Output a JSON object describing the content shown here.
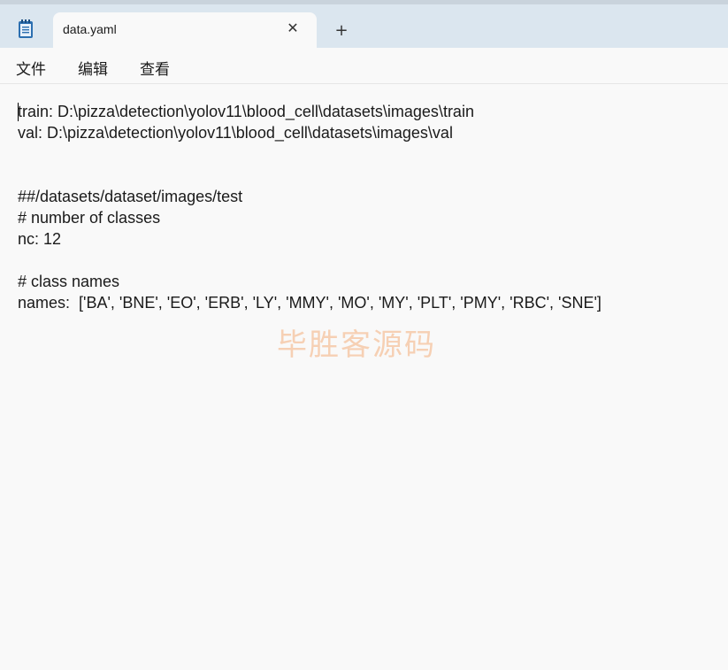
{
  "window": {
    "tab_title": "data.yaml",
    "close_glyph": "✕",
    "new_tab_glyph": "+"
  },
  "menu": {
    "file": "文件",
    "edit": "编辑",
    "view": "查看"
  },
  "editor": {
    "lines": [
      "train: D:\\pizza\\detection\\yolov11\\blood_cell\\datasets\\images\\train",
      "val: D:\\pizza\\detection\\yolov11\\blood_cell\\datasets\\images\\val",
      "",
      "",
      "##/datasets/dataset/images/test",
      "# number of classes",
      "nc: 12",
      "",
      "# class names",
      "names:  ['BA', 'BNE', 'EO', 'ERB', 'LY', 'MMY', 'MO', 'MY', 'PLT', 'PMY', 'RBC', 'SNE']"
    ]
  },
  "watermark": "毕胜客源码",
  "colors": {
    "titlebar": "#dbe6ef",
    "editor_bg": "#f9f9f9",
    "watermark": "#f6c9a8"
  },
  "icons": {
    "app": "notepad-icon",
    "close": "close-icon",
    "new_tab": "plus-icon"
  }
}
